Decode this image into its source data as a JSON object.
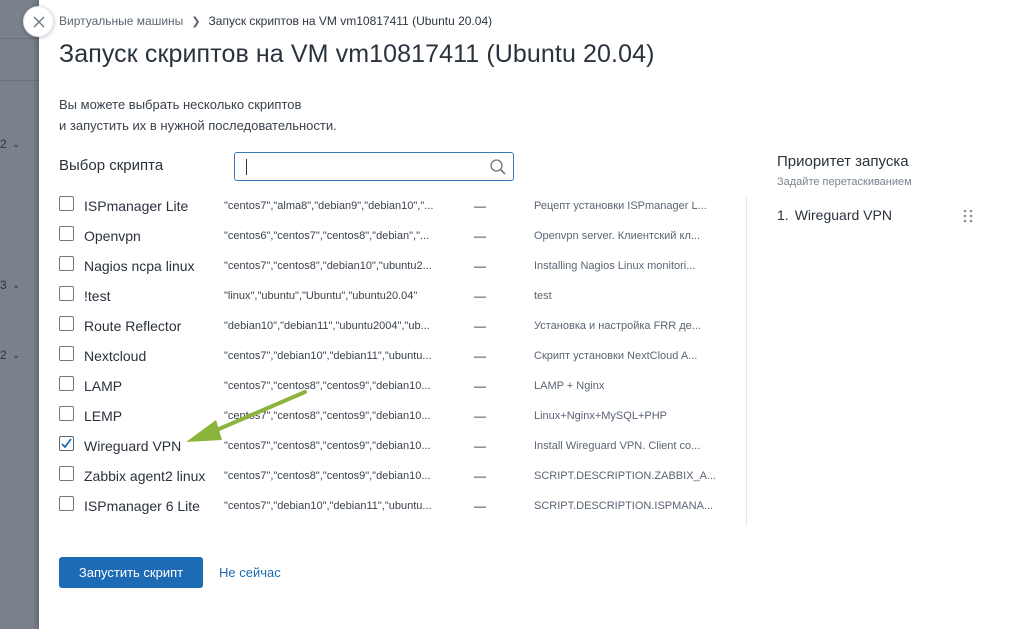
{
  "backdrop": {
    "numbers": [
      "2",
      "3",
      "2"
    ]
  },
  "breadcrumb": {
    "parent": "Виртуальные машины",
    "current": "Запуск скриптов на VM vm10817411 (Ubuntu 20.04)"
  },
  "page": {
    "title": "Запуск скриптов на VM vm10817411 (Ubuntu 20.04)",
    "intro_line1": "Вы можете выбрать несколько скриптов",
    "intro_line2": "и запустить их в нужной последовательности."
  },
  "selector": {
    "label": "Выбор скрипта",
    "search_value": "",
    "search_placeholder": ""
  },
  "scripts": [
    {
      "name": "ISPmanager Lite",
      "os": "\"centos7\",\"alma8\",\"debian9\",\"debian10\",\"...",
      "dash": "—",
      "desc": "Рецепт установки ISPmanager L...",
      "checked": false
    },
    {
      "name": "Openvpn",
      "os": "\"centos6\",\"centos7\",\"centos8\",\"debian\",\"...",
      "dash": "—",
      "desc": "Openvpn server. Клиентский кл...",
      "checked": false
    },
    {
      "name": "Nagios ncpa linux",
      "os": "\"centos7\",\"centos8\",\"debian10\",\"ubuntu2...",
      "dash": "—",
      "desc": "Installing Nagios Linux monitori...",
      "checked": false
    },
    {
      "name": "!test",
      "os": "\"linux\",\"ubuntu\",\"Ubuntu\",\"ubuntu20.04\"",
      "dash": "—",
      "desc": "test",
      "checked": false
    },
    {
      "name": "Route Reflector",
      "os": "\"debian10\",\"debian11\",\"ubuntu2004\",\"ub...",
      "dash": "—",
      "desc": "Установка и настройка FRR де...",
      "checked": false
    },
    {
      "name": "Nextcloud",
      "os": "\"centos7\",\"debian10\",\"debian11\",\"ubuntu...",
      "dash": "—",
      "desc": "Скрипт установки NextCloud A...",
      "checked": false
    },
    {
      "name": "LAMP",
      "os": "\"centos7\",\"centos8\",\"centos9\",\"debian10...",
      "dash": "—",
      "desc": "LAMP + Nginx",
      "checked": false
    },
    {
      "name": "LEMP",
      "os": "\"centos7\",\"centos8\",\"centos9\",\"debian10...",
      "dash": "—",
      "desc": "Linux+Nginx+MySQL+PHP",
      "checked": false
    },
    {
      "name": "Wireguard VPN",
      "os": "\"centos7\",\"centos8\",\"centos9\",\"debian10...",
      "dash": "—",
      "desc": "Install Wireguard VPN. Client co...",
      "checked": true
    },
    {
      "name": "Zabbix agent2 linux",
      "os": "\"centos7\",\"centos8\",\"centos9\",\"debian10...",
      "dash": "—",
      "desc": "SCRIPT.DESCRIPTION.ZABBIX_A...",
      "checked": false
    },
    {
      "name": "ISPmanager 6 Lite",
      "os": "\"centos7\",\"debian10\",\"debian11\",\"ubuntu...",
      "dash": "—",
      "desc": "SCRIPT.DESCRIPTION.ISPMANA...",
      "checked": false
    }
  ],
  "priority": {
    "title": "Приоритет запуска",
    "hint": "Задайте перетаскиванием",
    "items": [
      {
        "num": "1.",
        "label": "Wireguard VPN"
      }
    ]
  },
  "actions": {
    "run_label": "Запустить скрипт",
    "later_label": "Не сейчас"
  },
  "colors": {
    "accent": "#1e6bb5",
    "annotation_arrow": "#8cb43c"
  },
  "icons": {
    "close": "close-icon",
    "search": "search-icon",
    "drag": "drag-handle-icon",
    "checkbox": "checkmark-icon"
  }
}
